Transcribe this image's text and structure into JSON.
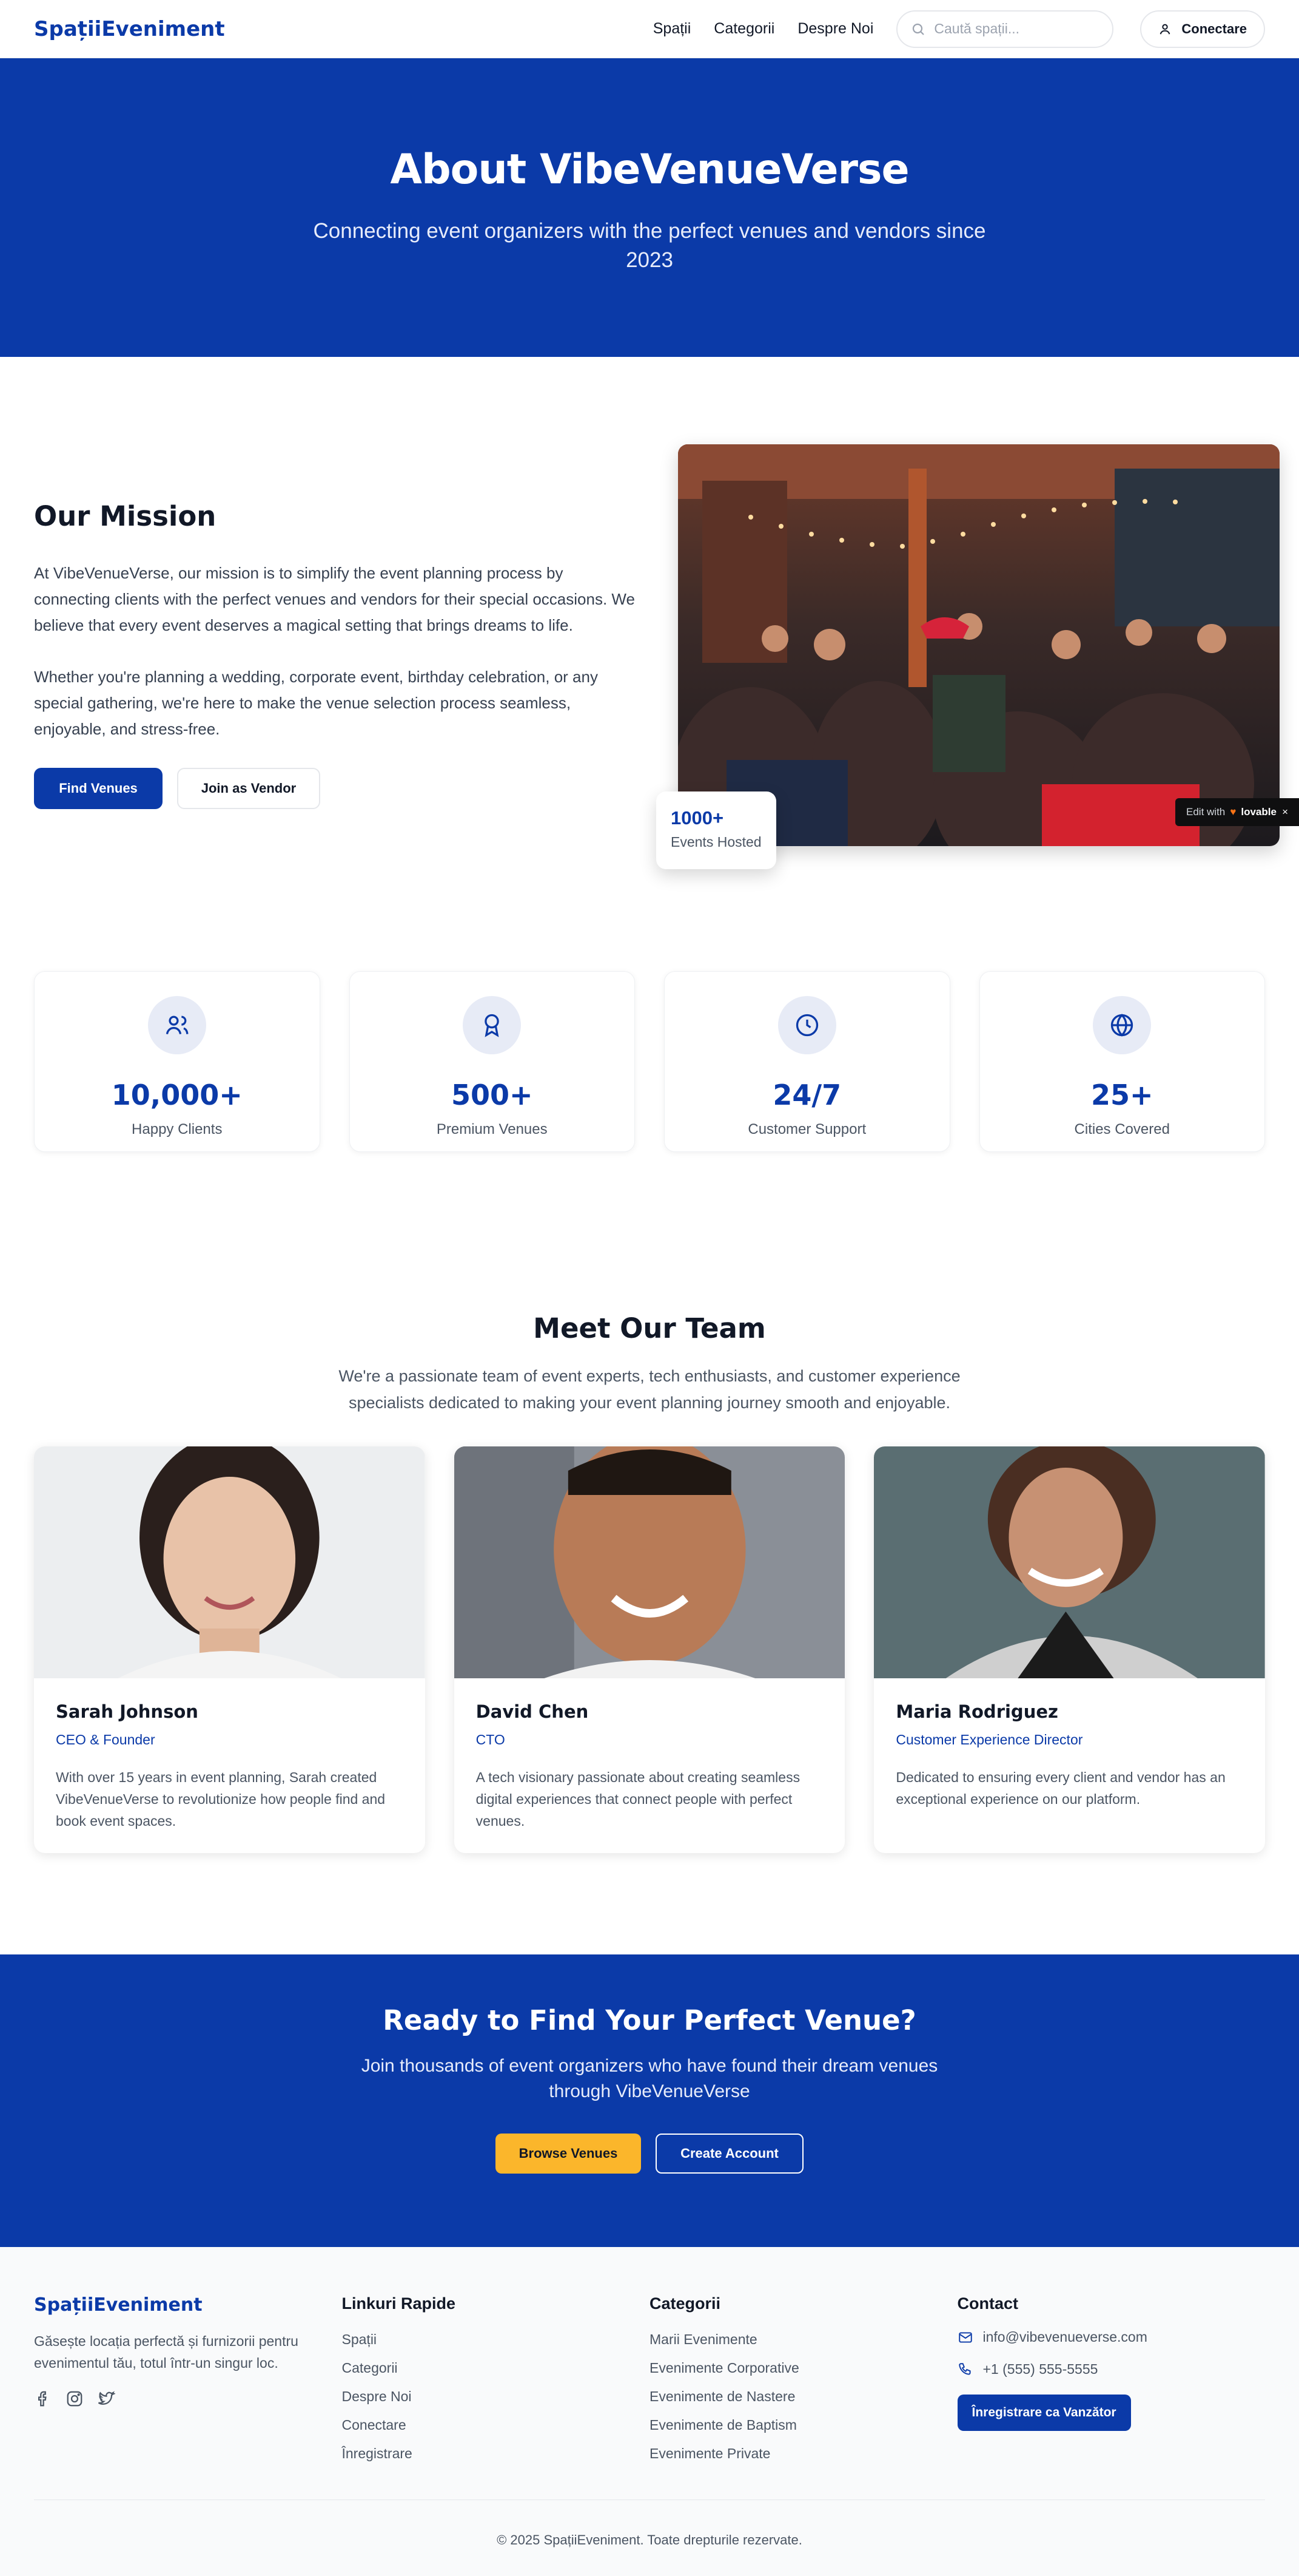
{
  "nav": {
    "brand": "SpațiiEveniment",
    "links": [
      "Spații",
      "Categorii",
      "Despre Noi"
    ],
    "search_placeholder": "Caută spații...",
    "login_label": "Conectare"
  },
  "hero": {
    "title": "About VibeVenueVerse",
    "subtitle": "Connecting event organizers with the perfect venues and vendors since 2023"
  },
  "mission": {
    "title": "Our Mission",
    "paragraph1": "At VibeVenueVerse, our mission is to simplify the event planning process by connecting clients with the perfect venues and vendors for their special occasions. We believe that every event deserves a magical setting that brings dreams to life.",
    "paragraph2": "Whether you're planning a wedding, corporate event, birthday celebration, or any special gathering, we're here to make the venue selection process seamless, enjoyable, and stress-free.",
    "primary_button": "Find Venues",
    "secondary_button": "Join as Vendor",
    "badge_value": "1000+",
    "badge_label": "Events Hosted",
    "lovable_prefix": "Edit with",
    "lovable_brand": "lovable"
  },
  "stats": [
    {
      "icon": "users-icon",
      "value": "10,000+",
      "label": "Happy Clients"
    },
    {
      "icon": "award-icon",
      "value": "500+",
      "label": "Premium Venues"
    },
    {
      "icon": "clock-icon",
      "value": "24/7",
      "label": "Customer Support"
    },
    {
      "icon": "globe-icon",
      "value": "25+",
      "label": "Cities Covered"
    }
  ],
  "team": {
    "title": "Meet Our Team",
    "subtitle": "We're a passionate team of event experts, tech enthusiasts, and customer experience specialists dedicated to making your event planning journey smooth and enjoyable.",
    "members": [
      {
        "name": "Sarah Johnson",
        "role": "CEO & Founder",
        "bio": "With over 15 years in event planning, Sarah created VibeVenueVerse to revolutionize how people find and book event spaces."
      },
      {
        "name": "David Chen",
        "role": "CTO",
        "bio": "A tech visionary passionate about creating seamless digital experiences that connect people with perfect venues."
      },
      {
        "name": "Maria Rodriguez",
        "role": "Customer Experience Director",
        "bio": "Dedicated to ensuring every client and vendor has an exceptional experience on our platform."
      }
    ]
  },
  "cta": {
    "title": "Ready to Find Your Perfect Venue?",
    "subtitle": "Join thousands of event organizers who have found their dream venues through VibeVenueVerse",
    "primary_button": "Browse Venues",
    "secondary_button": "Create Account"
  },
  "footer": {
    "brand": "SpațiiEveniment",
    "tagline": "Găsește locația perfectă și furnizorii pentru evenimentul tău, totul într-un singur loc.",
    "quick_links_title": "Linkuri Rapide",
    "quick_links": [
      "Spații",
      "Categorii",
      "Despre Noi",
      "Conectare",
      "Înregistrare"
    ],
    "categories_title": "Categorii",
    "categories": [
      "Marii Evenimente",
      "Evenimente Corporative",
      "Evenimente de Nastere",
      "Evenimente de Baptism",
      "Evenimente Private"
    ],
    "contact_title": "Contact",
    "email": "info@vibevenueverse.com",
    "phone": "+1 (555) 555-5555",
    "vendor_button": "Înregistrare ca Vanzător",
    "copyright": "© 2025 SpațiiEveniment. Toate drepturile rezervate."
  },
  "colors": {
    "primary": "#0b3aa8",
    "accent": "#fbb62b",
    "footer_bg": "#f9fafb"
  }
}
